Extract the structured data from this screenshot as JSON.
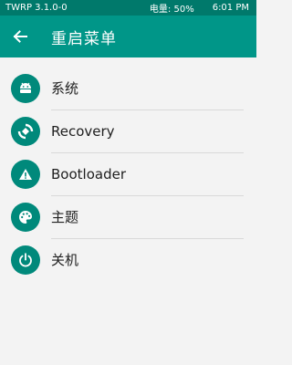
{
  "status_bar": {
    "left_text": "TWRP 3.1.0-0",
    "battery_text": "电量:  50%",
    "time_text": "6:01 PM"
  },
  "app_bar": {
    "back_icon": "arrow-left-icon",
    "title": "重启菜单"
  },
  "menu": {
    "items": [
      {
        "label": "系统",
        "icon": "android-icon"
      },
      {
        "label": "Recovery",
        "icon": "recovery-icon"
      },
      {
        "label": "Bootloader",
        "icon": "warning-icon"
      },
      {
        "label": "主题",
        "icon": "palette-icon"
      },
      {
        "label": "关机",
        "icon": "power-icon"
      }
    ]
  },
  "colors": {
    "status_bar": "#00796b",
    "app_bar": "#009688",
    "icon_circle": "#00897b",
    "background": "#f3f3f3",
    "divider": "#d9d9d9"
  }
}
